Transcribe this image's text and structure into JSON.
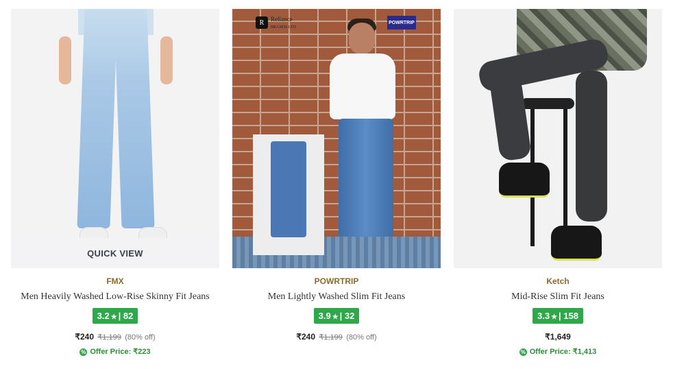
{
  "products": [
    {
      "brand": "FMX",
      "title": "Men Heavily Washed Low-Rise Skinny Fit Jeans",
      "rating": "3.2",
      "reviews": "82",
      "price": "₹240",
      "mrp": "₹1,199",
      "discount": "(80% off)",
      "offer_price": "Offer Price: ₹223",
      "quick_view": "QUICK VIEW"
    },
    {
      "brand": "POWRTRIP",
      "title": "Men Lightly Washed Slim Fit Jeans",
      "rating": "3.9",
      "reviews": "32",
      "price": "₹240",
      "mrp": "₹1,199",
      "discount": "(80% off)",
      "badge_left": "Reliance",
      "badge_left_sub": "BRANDS LTD",
      "badge_right": "POWRTRIP"
    },
    {
      "brand": "Ketch",
      "title": "Mid-Rise Slim Fit Jeans",
      "rating": "3.3",
      "reviews": "158",
      "price": "₹1,649",
      "offer_price": "Offer Price: ₹1,413"
    }
  ],
  "colors": {
    "rating_bg": "#2ea84a",
    "brand": "#8a6a2c",
    "offer": "#2c8f36"
  },
  "icons": {
    "rating": "star-icon",
    "offer": "offer-tag-icon"
  }
}
